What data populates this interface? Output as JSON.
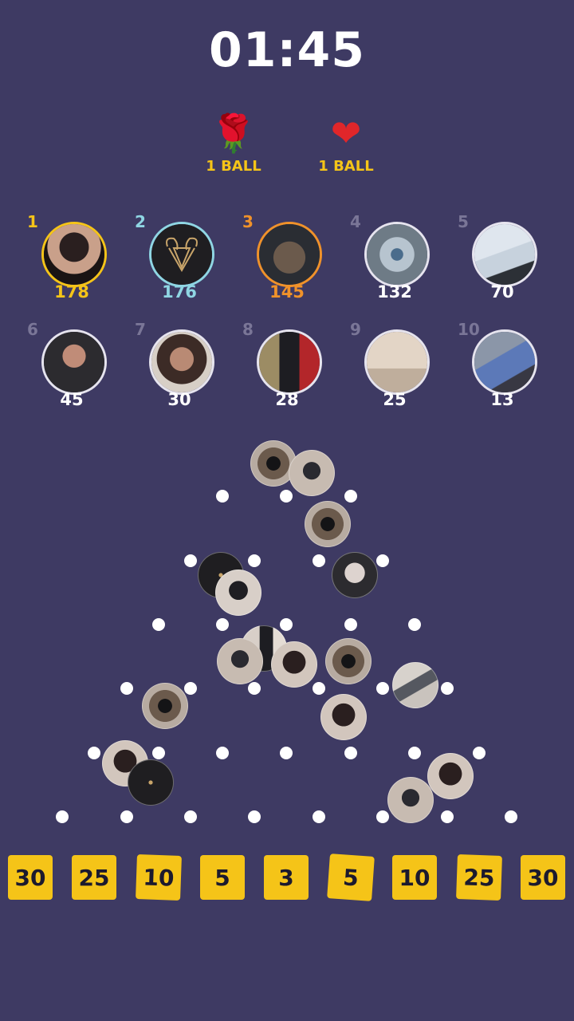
{
  "timer": "01:45",
  "gifts": [
    {
      "icon": "rose-icon",
      "glyph": "🌹",
      "label": "1 BALL"
    },
    {
      "icon": "heart-icon",
      "glyph": "❤",
      "label": "1 BALL"
    }
  ],
  "leaderboard": [
    {
      "rank": "1",
      "score": "178"
    },
    {
      "rank": "2",
      "score": "176"
    },
    {
      "rank": "3",
      "score": "145"
    },
    {
      "rank": "4",
      "score": "132"
    },
    {
      "rank": "5",
      "score": "70"
    },
    {
      "rank": "6",
      "score": "45"
    },
    {
      "rank": "7",
      "score": "30"
    },
    {
      "rank": "8",
      "score": "28"
    },
    {
      "rank": "9",
      "score": "25"
    },
    {
      "rank": "10",
      "score": "13"
    }
  ],
  "buckets": [
    "30",
    "25",
    "10",
    "5",
    "3",
    "5",
    "10",
    "25",
    "30"
  ],
  "colors": {
    "background": "#3e3a63",
    "gold": "#f5c418",
    "silver": "#8fd6e3",
    "bronze": "#f0922a",
    "rank_muted": "#7a7697",
    "bucket": "#f5c418"
  }
}
